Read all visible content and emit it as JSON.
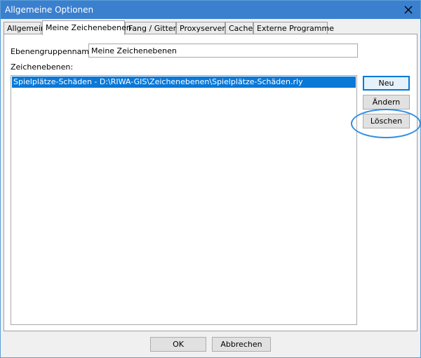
{
  "window": {
    "title": "Allgemeine Optionen"
  },
  "tabs": [
    {
      "label": "Allgemein",
      "active": false
    },
    {
      "label": "Meine Zeichenebenen",
      "active": true
    },
    {
      "label": "Fang / Gitter",
      "active": false
    },
    {
      "label": "Proxyserver",
      "active": false
    },
    {
      "label": "Cache",
      "active": false
    },
    {
      "label": "Externe Programme",
      "active": false
    }
  ],
  "form": {
    "group_name_label": "Ebenengruppenname:",
    "group_name_value": "Meine Zeichenebenen",
    "layers_label": "Zeichenebenen:",
    "layers": [
      "Spielplätze-Schäden - D:\\RIWA-GIS\\Zeichenebenen\\Spielplätze-Schäden.rly"
    ]
  },
  "side_buttons": {
    "new_label": "Neu",
    "edit_label": "Ändern",
    "delete_label": "Löschen"
  },
  "footer": {
    "ok_label": "OK",
    "cancel_label": "Abbrechen"
  },
  "colors": {
    "titlebar": "#3b7fcf",
    "selection": "#0a78d7",
    "highlight_ring": "#2f8de4"
  }
}
